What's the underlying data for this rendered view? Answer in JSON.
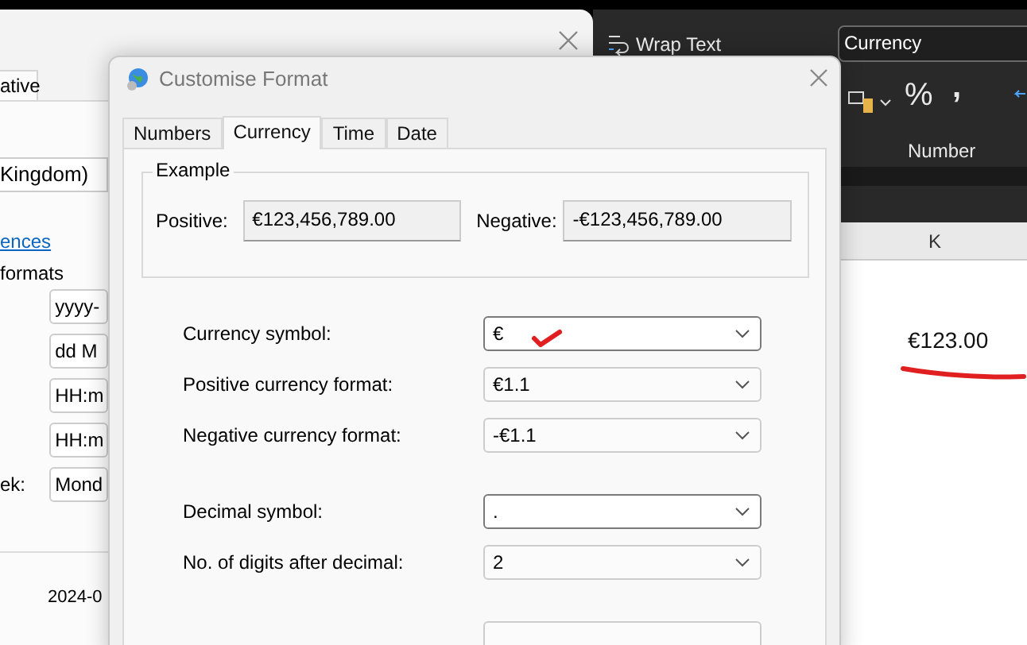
{
  "back_dialog": {
    "tab": "ative",
    "region_value": "Kingdom)",
    "link": "ences",
    "group_label": "formats",
    "format_fields": [
      "yyyy-",
      "dd M",
      "HH:m",
      "HH:m",
      "Mond"
    ],
    "week_label": "ek:",
    "sample": "2024-0"
  },
  "ribbon": {
    "wrap_text": "Wrap Text",
    "number_format": "Currency",
    "percent": "%",
    "comma": ",",
    "group_label": "Number"
  },
  "sheet": {
    "column": "K",
    "cell": "€123.00"
  },
  "dialog": {
    "title": "Customise Format",
    "tabs": [
      {
        "label": "Numbers",
        "selected": false
      },
      {
        "label": "Currency",
        "selected": true
      },
      {
        "label": "Time",
        "selected": false
      },
      {
        "label": "Date",
        "selected": false
      }
    ],
    "example": {
      "title": "Example",
      "positive_label": "Positive:",
      "positive_value": "€123,456,789.00",
      "negative_label": "Negative:",
      "negative_value": "-€123,456,789.00"
    },
    "setting_groups": [
      [
        {
          "label": "Currency symbol:",
          "value": "€",
          "focused": true
        },
        {
          "label": "Positive currency format:",
          "value": "€1.1",
          "focused": false
        },
        {
          "label": "Negative currency format:",
          "value": "-€1.1",
          "focused": false
        }
      ],
      [
        {
          "label": "Decimal symbol:",
          "value": ".",
          "focused": true
        },
        {
          "label": "No. of digits after decimal:",
          "value": "2",
          "focused": false
        }
      ]
    ]
  }
}
